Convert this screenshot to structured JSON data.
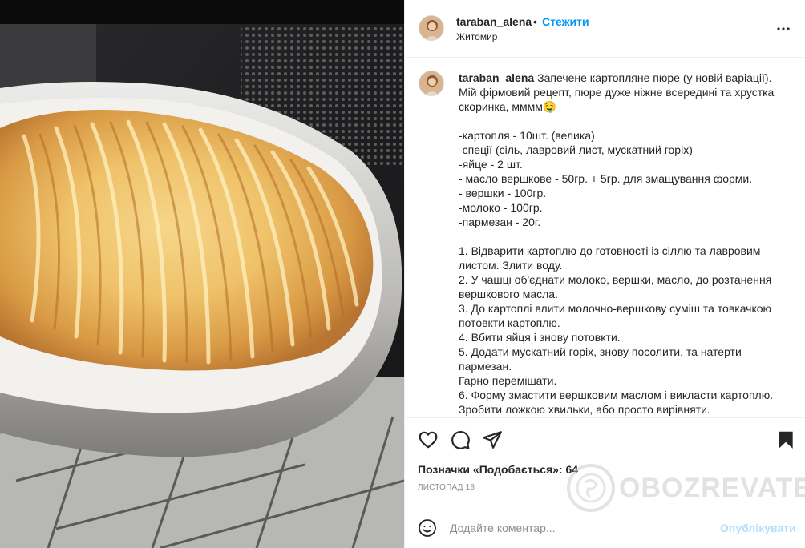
{
  "post": {
    "username": "taraban_alena",
    "follow_label": "Стежити",
    "separator": "•",
    "location": "Житомир",
    "more_icon": "more-horizontal-icon"
  },
  "caption": {
    "username": "taraban_alena",
    "text": "Запечене картопляне пюре (у новій варіації). Мій фірмовий рецепт, пюре дуже ніжне всередині та хрустка скоринка, мммм🤤\n\n-картопля - 10шт. (велика)\n-спеції (сіль, лавровий лист, мускатний горіх)\n-яйце - 2 шт.\n- масло вершкове - 50гр. + 5гр. для змащування форми.\n- вершки - 100гр.\n-молоко - 100гр.\n-пармезан - 20г.\n\n1. Відварити картоплю до готовності із сіллю та лавровим листом. Злити воду.\n2. У чашці об'єднати молоко, вершки, масло, до розтанення вершкового масла.\n3. До картоплі влити молочно-вершкову суміш та товкачкою потовкти картоплю.\n4. Вбити яйця і знову потовкти.\n5. Додати мускатний горіх, знову посолити, та натерти пармезан.\nГарно перемішати.\n6. Форму змастити вершковим маслом і викласти картоплю. Зробити ложкою хвильки, або просто вирівняти."
  },
  "actions": {
    "like_icon": "heart-icon",
    "comment_icon": "comment-icon",
    "share_icon": "share-icon",
    "save_icon": "bookmark-icon",
    "likes_text": "Позначки «Подобається»: 64",
    "date": "листопад 18"
  },
  "comment": {
    "emoji_icon": "emoji-icon",
    "placeholder": "Додайте коментар...",
    "publish_label": "Опублікувати"
  },
  "watermark": {
    "text": "OBOZREVATEL"
  },
  "colors": {
    "accent": "#0095f6",
    "publish_disabled": "#b2dffc",
    "muted": "#8e8e8e",
    "border": "#efefef"
  }
}
